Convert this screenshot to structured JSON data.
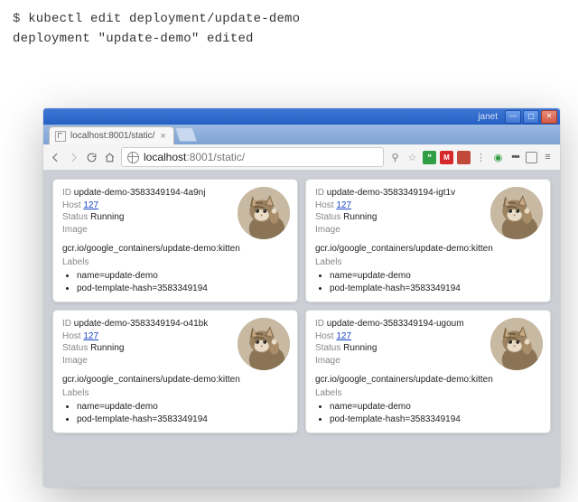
{
  "terminal": {
    "prompt": "$ ",
    "command": "kubectl edit deployment/update-demo",
    "output": "deployment \"update-demo\" edited"
  },
  "browser": {
    "window_user": "janet",
    "tab_title": "localhost:8001/static/",
    "url_host": "localhost",
    "url_port_path": ":8001/static/",
    "ext_icons": [
      "search-icon",
      "star-icon",
      "hangouts-icon",
      "gmail-icon",
      "redblock-icon",
      "refresh-icon",
      "green-dot-icon",
      "more-icon",
      "devtools-icon",
      "menu-icon"
    ]
  },
  "field_labels": {
    "id": "ID",
    "host": "Host",
    "status": "Status",
    "image": "Image",
    "labels": "Labels"
  },
  "pods": [
    {
      "id": "update-demo-3583349194-4a9nj",
      "host": "127",
      "status": "Running",
      "image_path": "gcr.io/google_containers/update-demo:kitten",
      "labels": [
        "name=update-demo",
        "pod-template-hash=3583349194"
      ]
    },
    {
      "id": "update-demo-3583349194-igt1v",
      "host": "127",
      "status": "Running",
      "image_path": "gcr.io/google_containers/update-demo:kitten",
      "labels": [
        "name=update-demo",
        "pod-template-hash=3583349194"
      ]
    },
    {
      "id": "update-demo-3583349194-o41bk",
      "host": "127",
      "status": "Running",
      "image_path": "gcr.io/google_containers/update-demo:kitten",
      "labels": [
        "name=update-demo",
        "pod-template-hash=3583349194"
      ]
    },
    {
      "id": "update-demo-3583349194-ugoum",
      "host": "127",
      "status": "Running",
      "image_path": "gcr.io/google_containers/update-demo:kitten",
      "labels": [
        "name=update-demo",
        "pod-template-hash=3583349194"
      ]
    }
  ]
}
